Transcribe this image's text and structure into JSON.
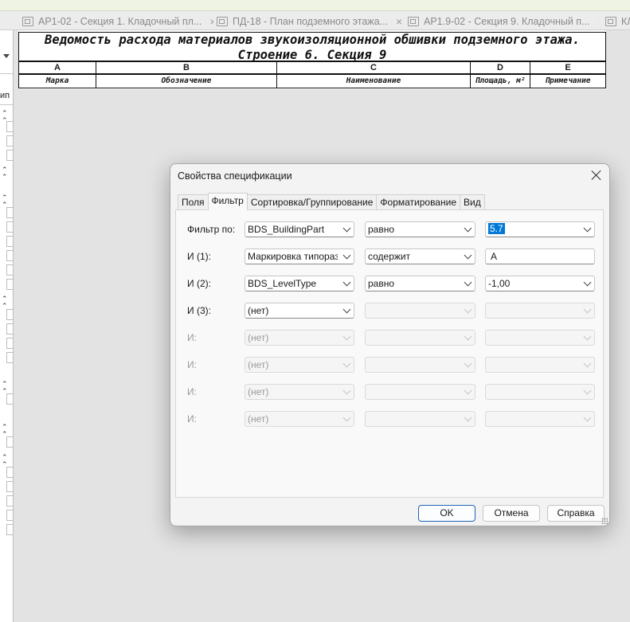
{
  "tabs": [
    {
      "label": "АР1-02 - Секция 1. Кладочный пл...",
      "close": "×"
    },
    {
      "label": "ПД-18 - План подземного этажа...",
      "close": "×"
    },
    {
      "label": "АР1.9-02 - Секция 9. Кладочный п...",
      "close": "×"
    },
    {
      "label": "КЛ",
      "close": ""
    }
  ],
  "left_panel": {
    "text": "ип"
  },
  "schedule": {
    "title_line1": "Ведомость расхода материалов звукоизоляционной обшивки подземного этажа.",
    "title_line2": "Строение 6. Секция 9",
    "columns": [
      {
        "letter": "A",
        "header": "Марка"
      },
      {
        "letter": "B",
        "header": "Обозначение"
      },
      {
        "letter": "C",
        "header": "Наименование"
      },
      {
        "letter": "D",
        "header": "Площадь, м²"
      },
      {
        "letter": "E",
        "header": "Примечание"
      }
    ]
  },
  "dialog": {
    "title": "Свойства спецификации",
    "tabs": [
      "Поля",
      "Фильтр",
      "Сортировка/Группирование",
      "Форматирование",
      "Вид"
    ],
    "active_tab": "Фильтр",
    "filters": [
      {
        "label": "Фильтр по:",
        "field": "BDS_BuildingPart",
        "condition": "равно",
        "value": "5.7",
        "value_type": "combo",
        "enabled": true
      },
      {
        "label": "И (1):",
        "field": "Маркировка типоразмера",
        "condition": "содержит",
        "value": "А",
        "value_type": "text",
        "enabled": true
      },
      {
        "label": "И (2):",
        "field": "BDS_LevelType",
        "condition": "равно",
        "value": "-1,00",
        "value_type": "combo",
        "enabled": true
      },
      {
        "label": "И (3):",
        "field": "(нет)",
        "condition": "",
        "value": "",
        "value_type": "combo",
        "enabled": true,
        "rest_disabled": true
      },
      {
        "label": "И:",
        "field": "(нет)",
        "condition": "",
        "value": "",
        "value_type": "combo",
        "enabled": false
      },
      {
        "label": "И:",
        "field": "(нет)",
        "condition": "",
        "value": "",
        "value_type": "combo",
        "enabled": false
      },
      {
        "label": "И:",
        "field": "(нет)",
        "condition": "",
        "value": "",
        "value_type": "combo",
        "enabled": false
      },
      {
        "label": "И:",
        "field": "(нет)",
        "condition": "",
        "value": "",
        "value_type": "combo",
        "enabled": false
      }
    ],
    "buttons": {
      "ok": "OK",
      "cancel": "Отмена",
      "help": "Справка"
    }
  },
  "colors": {
    "accent": "#0078d7",
    "primary_button_border": "#1f63b5",
    "canvas": "#e3e3e3"
  }
}
